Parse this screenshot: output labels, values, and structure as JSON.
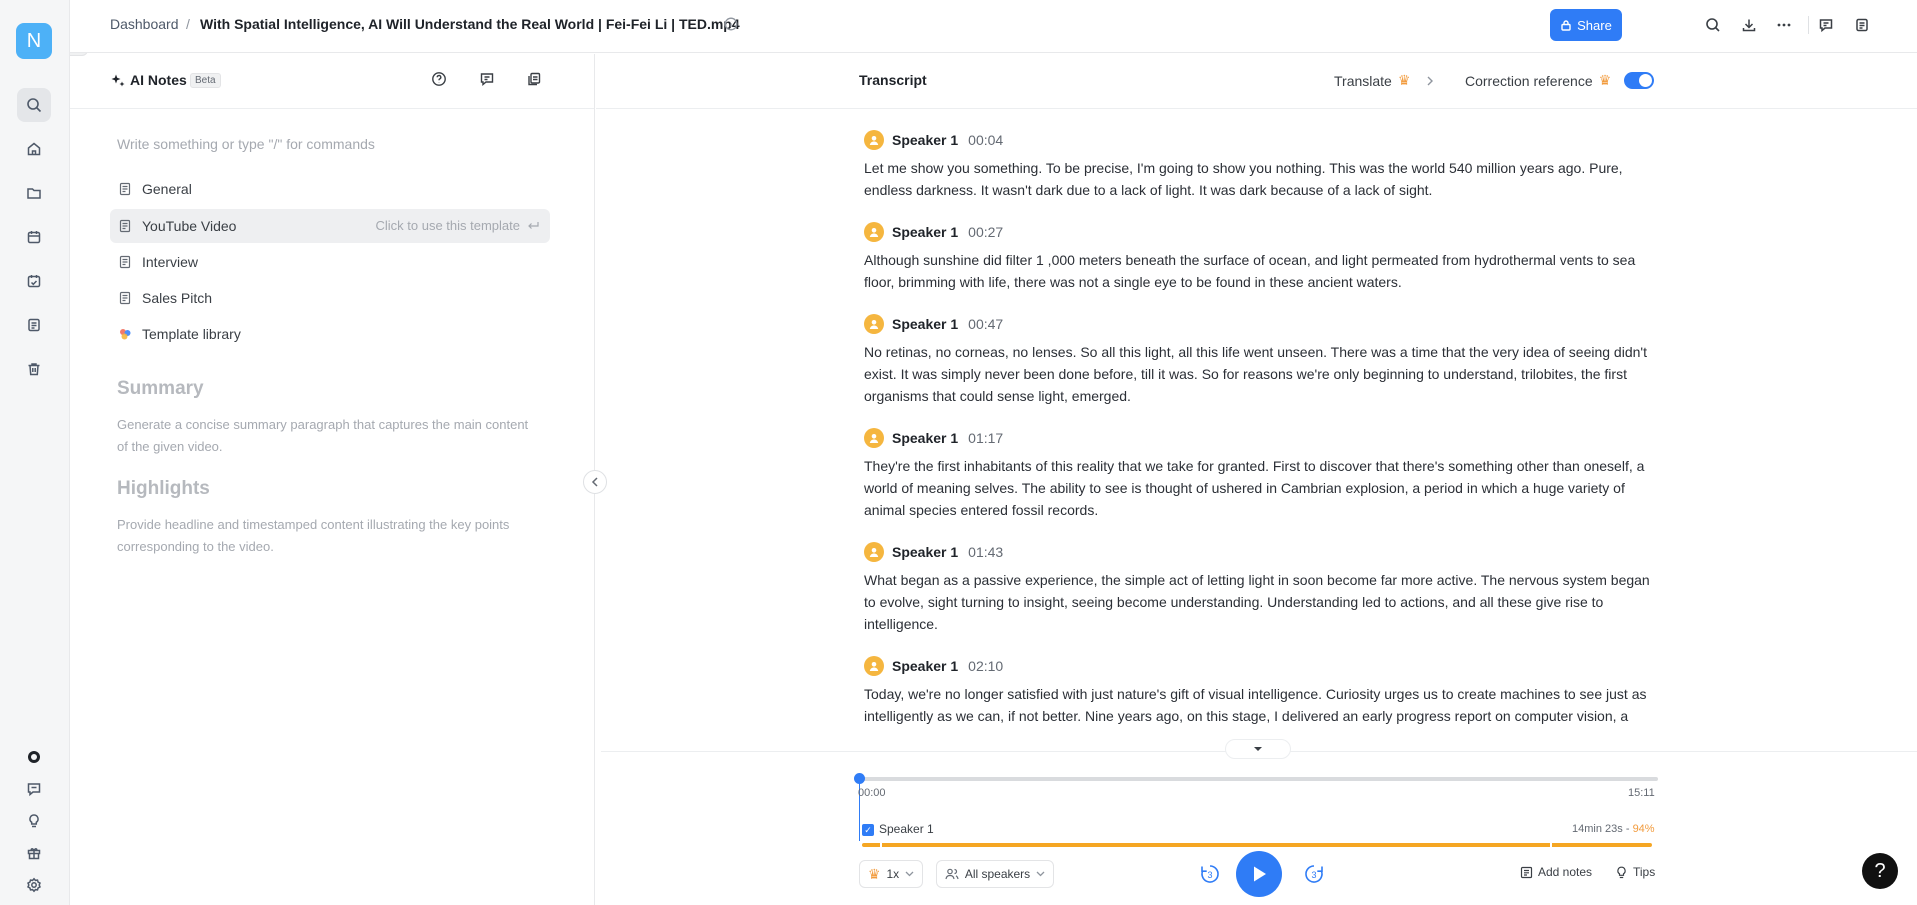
{
  "app": {
    "logo_letter": "N"
  },
  "breadcrumb": {
    "root": "Dashboard",
    "separator": "/",
    "title": "With Spatial Intelligence, AI Will Understand the Real World | Fei-Fei Li | TED.mp4"
  },
  "toolbar": {
    "share_label": "Share"
  },
  "notes": {
    "title": "AI Notes",
    "badge": "Beta",
    "placeholder": "Write something or type \"/\" for commands",
    "templates": [
      {
        "label": "General"
      },
      {
        "label": "YouTube Video",
        "hint": "Click to use this template"
      },
      {
        "label": "Interview"
      },
      {
        "label": "Sales Pitch"
      },
      {
        "label": "Template library"
      }
    ],
    "summary": {
      "title": "Summary",
      "description": "Generate a concise summary paragraph that captures the main content of the given video."
    },
    "highlights": {
      "title": "Highlights",
      "description": "Provide headline and timestamped content illustrating the key points corresponding to the video."
    }
  },
  "transcript": {
    "title": "Transcript",
    "translate_label": "Translate",
    "correction_label": "Correction reference",
    "correction_enabled": true,
    "segments": [
      {
        "speaker": "Speaker 1",
        "time": "00:04",
        "text": "Let me show you something. To be precise, I'm going to show you nothing. This was the world 540 million years ago. Pure, endless darkness. It wasn't dark due to a lack of light. It was dark because of a lack of sight."
      },
      {
        "speaker": "Speaker 1",
        "time": "00:27",
        "text": "Although sunshine did filter 1 ,000 meters beneath the surface of ocean, and light permeated from hydrothermal vents to sea floor, brimming with life, there was not a single eye to be found in these ancient waters."
      },
      {
        "speaker": "Speaker 1",
        "time": "00:47",
        "text": "No retinas, no corneas, no lenses. So all this light, all this life went unseen. There was a time that the very idea of seeing didn't exist. It was simply never been done before, till it was. So for reasons we're only beginning to understand, trilobites, the first organisms that could sense light, emerged."
      },
      {
        "speaker": "Speaker 1",
        "time": "01:17",
        "text": "They're the first inhabitants of this reality that we take for granted. First to discover that there's something other than oneself, a world of meaning selves. The ability to see is thought of ushered in Cambrian explosion, a period in which a huge variety of animal species entered fossil records."
      },
      {
        "speaker": "Speaker 1",
        "time": "01:43",
        "text": "What began as a passive experience, the simple act of letting light in soon become far more active. The nervous system began to evolve, sight turning to insight, seeing become understanding. Understanding led to actions, and all these give rise to intelligence."
      },
      {
        "speaker": "Speaker 1",
        "time": "02:10",
        "text": "Today, we're no longer satisfied with just nature's gift of visual intelligence. Curiosity urges us to create machines to see just as intelligently as we can, if not better. Nine years ago, on this stage, I delivered an early progress report on computer vision, a"
      }
    ]
  },
  "player": {
    "current_time": "00:00",
    "total_time": "15:11",
    "progress_fraction": 0,
    "speaker_filter": {
      "label": "Speaker 1",
      "checked": true,
      "duration": "14min 23s",
      "percent": "94%"
    },
    "speed": "1x",
    "speakers_label": "All speakers",
    "skip_back_seconds": "3",
    "skip_forward_seconds": "3",
    "add_notes_label": "Add notes",
    "tips_label": "Tips"
  },
  "colors": {
    "accent": "#2f7cf6",
    "speaker_bar": "#f5a623",
    "premium": "#f29b3d"
  }
}
